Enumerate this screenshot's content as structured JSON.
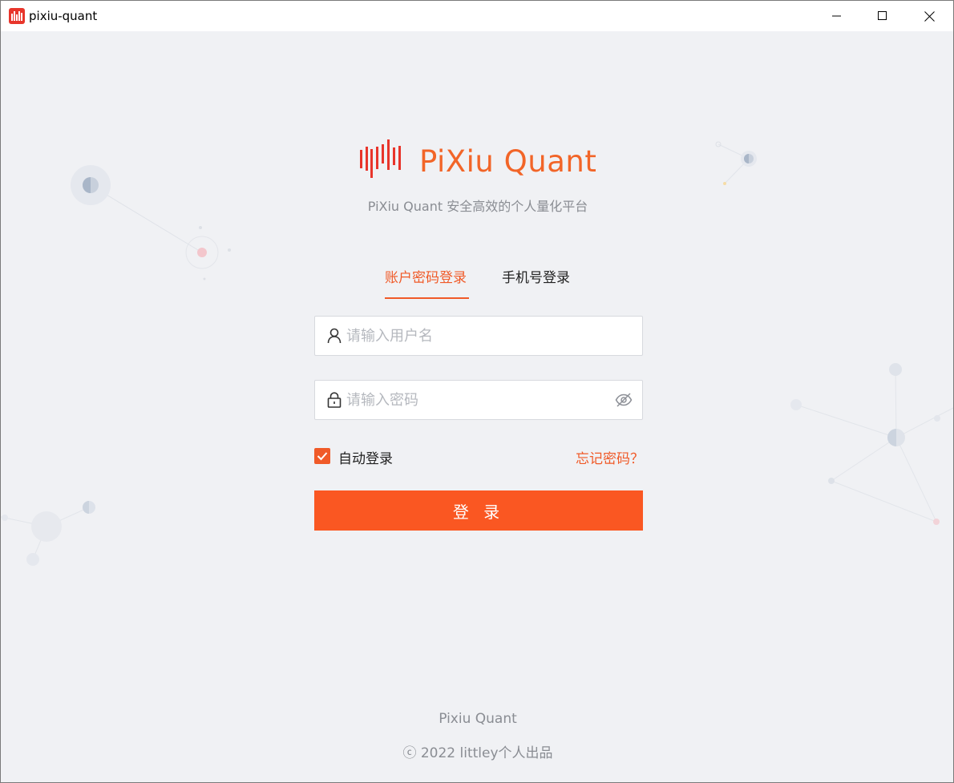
{
  "window": {
    "title": "pixiu-quant",
    "accent": "#e8352b"
  },
  "brand": {
    "name": "PiXiu Quant",
    "subtitle": "PiXiu Quant 安全高效的个人量化平台",
    "color": "#f26528"
  },
  "tabs": {
    "account": "账户密码登录",
    "phone": "手机号登录"
  },
  "form": {
    "username_placeholder": "请输入用户名",
    "password_placeholder": "请输入密码",
    "auto_login_label": "自动登录",
    "auto_login_checked": true,
    "forgot_label": "忘记密码？",
    "submit_label": "登 录",
    "button_color": "#fa5722"
  },
  "footer": {
    "line1": "Pixiu Quant",
    "line2": "ⓒ 2022 littley个人出品"
  },
  "icons": [
    "app-icon",
    "minimize-icon",
    "maximize-icon",
    "close-icon",
    "user-icon",
    "lock-icon",
    "eye-off-icon",
    "check-icon"
  ]
}
